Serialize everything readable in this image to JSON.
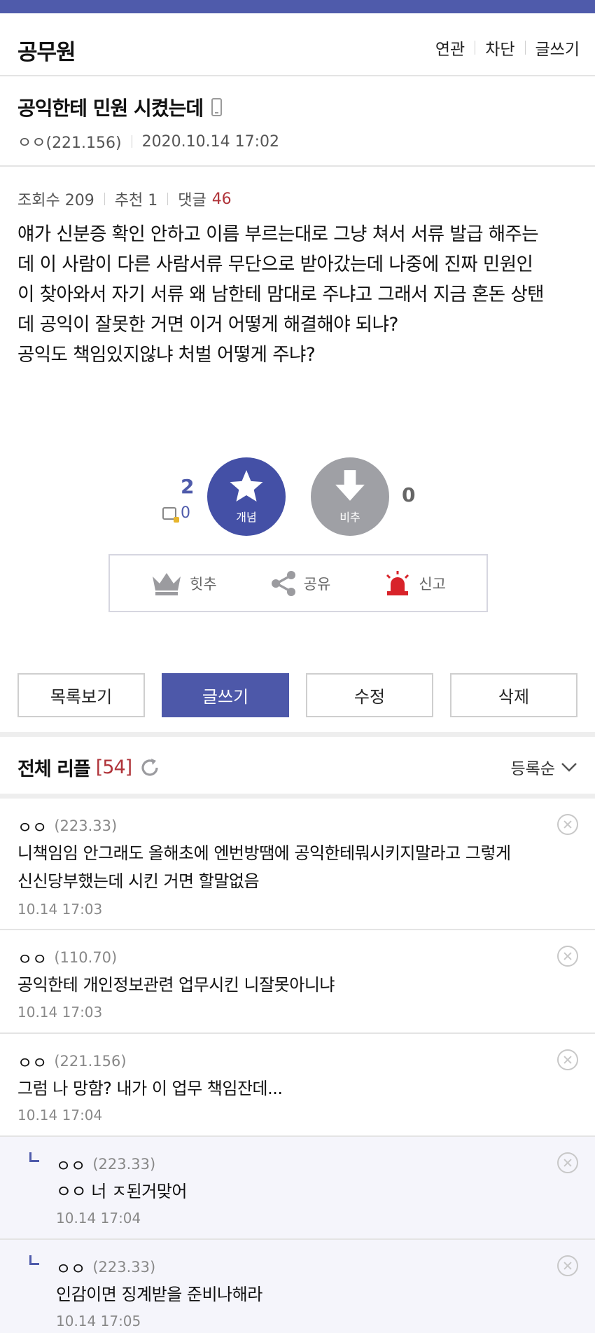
{
  "header": {
    "gallery_name": "공무원",
    "links": [
      "연관",
      "차단",
      "글쓰기"
    ]
  },
  "post": {
    "title": "공익한테 민원 시켰는데",
    "author": "ㅇㅇ(221.156)",
    "datetime": "2020.10.14 17:02",
    "views_label": "조회수 209",
    "recommend_label": "추천 1",
    "comments_label": "댓글",
    "comments_count": "46",
    "body_lines": [
      "얘가 신분증 확인 안하고 이름 부르는대로 그냥 쳐서 서류 발급 해주는",
      "데 이 사람이 다른 사람서류 무단으로 받아갔는데 나중에 진짜 민원인",
      "이 찾아와서 자기 서류 왜 남한테 맘대로 주냐고 그래서 지금 혼돈 상탠",
      "데 공익이 잘못한 거면 이거 어떻게 해결해야 되냐?",
      "공익도 책임있지않냐 처벌 어떻게 주냐?"
    ]
  },
  "vote": {
    "up_count": "2",
    "up_sub_count": "0",
    "up_label": "개념",
    "down_label": "비추",
    "down_count": "0"
  },
  "actions": {
    "hit": "힛추",
    "share": "공유",
    "report": "신고"
  },
  "buttons": {
    "list": "목록보기",
    "write": "글쓰기",
    "edit": "수정",
    "delete": "삭제"
  },
  "replies": {
    "title": "전체 리플",
    "count": "[54]",
    "sort_label": "등록순",
    "items": [
      {
        "author": "ㅇㅇ",
        "ip": "(223.33)",
        "lines": [
          "니책임임 안그래도 올해초에 엔번방땜에 공익한테뭐시키지말라고 그렇게",
          "신신당부했는데 시킨 거면 할말없음"
        ],
        "date": "10.14 17:03"
      },
      {
        "author": "ㅇㅇ",
        "ip": "(110.70)",
        "lines": [
          "공익한테 개인정보관련 업무시킨 니잘못아니냐"
        ],
        "date": "10.14 17:03"
      },
      {
        "author": "ㅇㅇ",
        "ip": "(221.156)",
        "lines": [
          "그럼 나 망함? 내가 이 업무 책임잔데..."
        ],
        "date": "10.14 17:04"
      },
      {
        "author": "ㅇㅇ",
        "ip": "(223.33)",
        "lines": [
          "ㅇㅇ 너 ㅈ된거맞어"
        ],
        "date": "10.14 17:04"
      },
      {
        "author": "ㅇㅇ",
        "ip": "(223.33)",
        "lines": [
          "인감이면 징계받을 준비나해라"
        ],
        "date": "10.14 17:05"
      }
    ]
  },
  "colors": {
    "accent": "#4f5bab",
    "red": "#b0343a"
  }
}
